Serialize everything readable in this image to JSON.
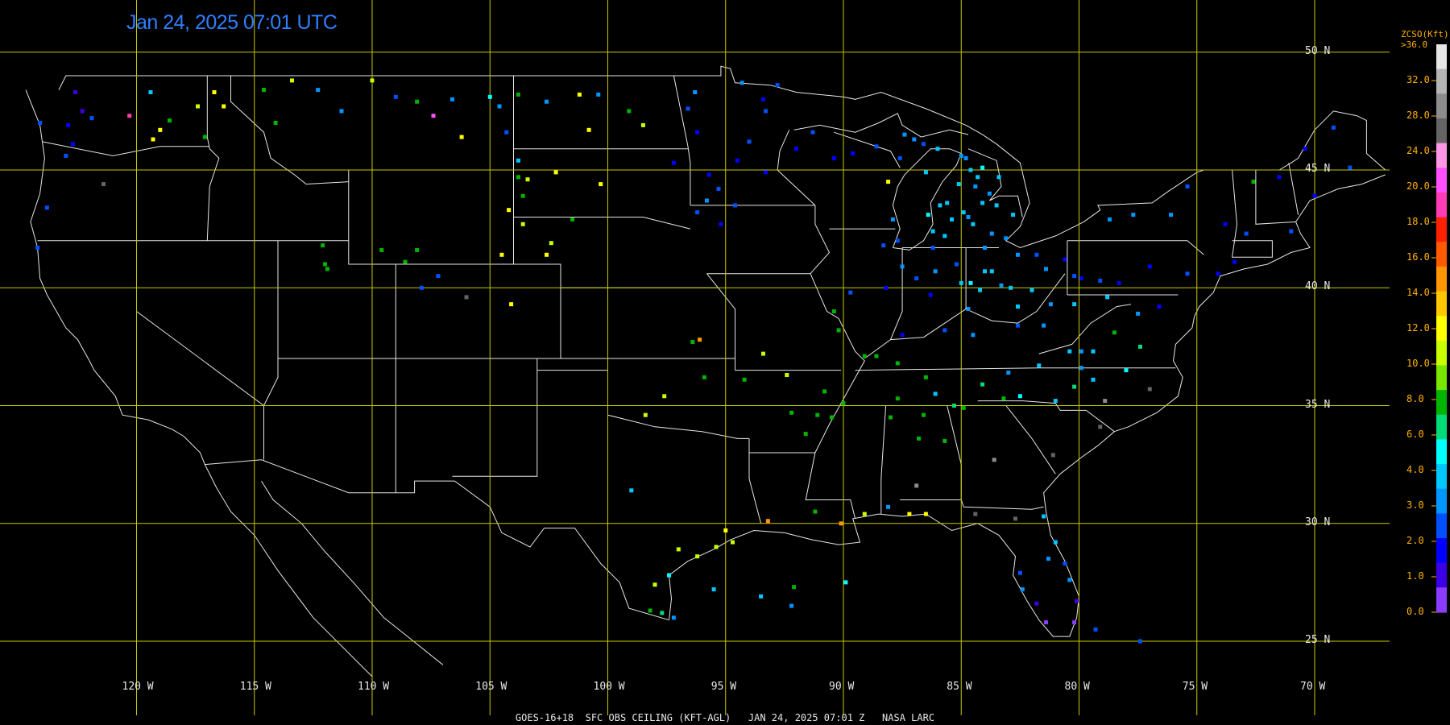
{
  "header": {
    "timestamp": "Jan 24, 2025 07:01 UTC"
  },
  "footer": {
    "caption": "GOES-16+18  SFC OBS CEILING (KFT-AGL)   JAN 24, 2025 07:01 Z   NASA LARC"
  },
  "colors": {
    "grid": "#c8c800",
    "borders": "#e6e6e6",
    "title": "#2f7fff",
    "legend_text": "#ffb000"
  },
  "map": {
    "projection": "equirectangular",
    "lon_range": [
      -125,
      -67
    ],
    "lat_range": [
      24,
      51
    ],
    "latitude_labels": [
      {
        "lat": 50,
        "text": "50 N"
      },
      {
        "lat": 45,
        "text": "45 N"
      },
      {
        "lat": 40,
        "text": "40 N"
      },
      {
        "lat": 35,
        "text": "35 N"
      },
      {
        "lat": 30,
        "text": "30 N"
      },
      {
        "lat": 25,
        "text": "25 N"
      }
    ],
    "longitude_labels": [
      {
        "lon": -120,
        "text": "120 W"
      },
      {
        "lon": -115,
        "text": "115 W"
      },
      {
        "lon": -110,
        "text": "110 W"
      },
      {
        "lon": -105,
        "text": "105 W"
      },
      {
        "lon": -100,
        "text": "100 W"
      },
      {
        "lon": -95,
        "text": "95 W"
      },
      {
        "lon": -90,
        "text": "90 W"
      },
      {
        "lon": -85,
        "text": "85 W"
      },
      {
        "lon": -80,
        "text": "80 W"
      },
      {
        "lon": -75,
        "text": "75 W"
      },
      {
        "lon": -70,
        "text": "70 W"
      }
    ]
  },
  "legend": {
    "title": "ZCSO(Kft)",
    "top_label": ">36.0",
    "ticks": [
      "32.0",
      "28.0",
      "24.0",
      "20.0",
      "18.0",
      "16.0",
      "14.0",
      "12.0",
      "10.0",
      "8.0",
      "6.0",
      "4.0",
      "3.0",
      "2.0",
      "1.0",
      "0.0"
    ],
    "colors": [
      "#e6e6e6",
      "#b4b4b4",
      "#8c8c8c",
      "#646464",
      "#ff96e6",
      "#ff50ff",
      "#ff3cb4",
      "#ff2000",
      "#ff5a00",
      "#ff9600",
      "#ffc800",
      "#ffff00",
      "#c8ff00",
      "#78e600",
      "#00b400",
      "#00dc78",
      "#00ffff",
      "#00c8ff",
      "#0096ff",
      "#0050ff",
      "#0000ff",
      "#3c00e6",
      "#8c3cff"
    ]
  },
  "chart_data": {
    "type": "scatter",
    "title": "",
    "xlabel": "",
    "ylabel": "",
    "xlim": [
      -125,
      -67
    ],
    "ylim": [
      24,
      51
    ],
    "note_units": "ceiling kft AGL",
    "points": [
      [
        -122.3,
        47.5,
        0.8
      ],
      [
        -122.6,
        48.3,
        0.9
      ],
      [
        -121.9,
        47.2,
        2.0
      ],
      [
        -122.9,
        46.9,
        1.5
      ],
      [
        -123.0,
        45.6,
        2.0
      ],
      [
        -124.1,
        47.0,
        2.5
      ],
      [
        -122.7,
        46.1,
        1.5
      ],
      [
        -123.8,
        43.4,
        2.0
      ],
      [
        -124.2,
        41.7,
        2.5
      ],
      [
        -119.4,
        48.3,
        4.0
      ],
      [
        -117.4,
        47.7,
        10.0
      ],
      [
        -116.3,
        47.7,
        12.0
      ],
      [
        -117.1,
        46.4,
        8.0
      ],
      [
        -118.6,
        47.1,
        8.0
      ],
      [
        -120.3,
        47.3,
        18.0
      ],
      [
        -119.3,
        46.3,
        12.0
      ],
      [
        -121.4,
        44.4,
        24.0
      ],
      [
        -119.0,
        46.7,
        12.0
      ],
      [
        -116.7,
        48.3,
        12.0
      ],
      [
        -114.6,
        48.4,
        8.0
      ],
      [
        -114.1,
        47.0,
        7.0
      ],
      [
        -113.4,
        48.8,
        10.0
      ],
      [
        -112.3,
        48.4,
        3.0
      ],
      [
        -111.3,
        47.5,
        3.0
      ],
      [
        -110.0,
        48.8,
        10.0
      ],
      [
        -109.0,
        48.1,
        2.5
      ],
      [
        -108.1,
        47.9,
        7.0
      ],
      [
        -106.6,
        48.0,
        3.0
      ],
      [
        -105.0,
        48.1,
        5.0
      ],
      [
        -104.6,
        47.7,
        3.0
      ],
      [
        -107.4,
        47.3,
        20.0
      ],
      [
        -106.2,
        46.4,
        12.0
      ],
      [
        -104.3,
        46.6,
        2.5
      ],
      [
        -103.8,
        48.2,
        7.0
      ],
      [
        -102.6,
        47.9,
        3.0
      ],
      [
        -101.2,
        48.2,
        12.0
      ],
      [
        -100.4,
        48.2,
        3.0
      ],
      [
        -99.1,
        47.5,
        8.0
      ],
      [
        -98.5,
        46.9,
        10.0
      ],
      [
        -100.8,
        46.7,
        12.0
      ],
      [
        -103.8,
        45.4,
        4.0
      ],
      [
        -102.2,
        44.9,
        12.0
      ],
      [
        -100.3,
        44.4,
        12.0
      ],
      [
        -103.4,
        44.6,
        10.0
      ],
      [
        -104.2,
        43.3,
        12.0
      ],
      [
        -101.5,
        42.9,
        8.0
      ],
      [
        -96.6,
        47.6,
        2.0
      ],
      [
        -96.2,
        46.6,
        1.5
      ],
      [
        -97.2,
        45.3,
        1.0
      ],
      [
        -95.7,
        44.8,
        1.5
      ],
      [
        -94.5,
        45.4,
        1.0
      ],
      [
        -94.0,
        46.2,
        2.0
      ],
      [
        -93.3,
        44.9,
        1.5
      ],
      [
        -92.0,
        45.9,
        1.0
      ],
      [
        -91.3,
        46.6,
        2.0
      ],
      [
        -90.4,
        45.5,
        1.5
      ],
      [
        -89.6,
        45.7,
        1.0
      ],
      [
        -88.6,
        46.0,
        2.0
      ],
      [
        -87.6,
        45.5,
        2.5
      ],
      [
        -88.1,
        44.5,
        12.0
      ],
      [
        -87.0,
        46.3,
        3.0
      ],
      [
        -86.0,
        45.9,
        4.0
      ],
      [
        -84.8,
        45.5,
        3.0
      ],
      [
        -84.3,
        44.7,
        4.0
      ],
      [
        -83.7,
        42.3,
        3.0
      ],
      [
        -84.7,
        43.0,
        3.5
      ],
      [
        -85.4,
        42.9,
        4.0
      ],
      [
        -86.2,
        42.4,
        4.0
      ],
      [
        -83.1,
        42.1,
        3.0
      ],
      [
        -82.6,
        41.4,
        3.0
      ],
      [
        -81.8,
        41.4,
        2.5
      ],
      [
        -80.6,
        41.2,
        1.5
      ],
      [
        -79.9,
        40.4,
        1.0
      ],
      [
        -78.3,
        40.2,
        1.5
      ],
      [
        -77.0,
        40.9,
        1.0
      ],
      [
        -75.4,
        40.6,
        2.0
      ],
      [
        -74.1,
        40.6,
        1.5
      ],
      [
        -73.4,
        41.1,
        1.0
      ],
      [
        -72.9,
        42.3,
        2.5
      ],
      [
        -71.0,
        42.4,
        2.0
      ],
      [
        -70.0,
        43.9,
        1.0
      ],
      [
        -76.1,
        43.1,
        3.0
      ],
      [
        -77.7,
        43.1,
        3.5
      ],
      [
        -78.7,
        42.9,
        3.0
      ],
      [
        -73.8,
        42.7,
        1.5
      ],
      [
        -75.4,
        44.3,
        2.0
      ],
      [
        -72.6,
        44.5,
        8.0
      ],
      [
        -71.5,
        44.7,
        1.5
      ],
      [
        -68.5,
        45.1,
        2.0
      ],
      [
        -70.4,
        45.9,
        1.5
      ],
      [
        -69.2,
        46.8,
        2.0
      ],
      [
        -83.3,
        40.1,
        3.0
      ],
      [
        -84.2,
        39.9,
        4.0
      ],
      [
        -84.7,
        39.1,
        3.0
      ],
      [
        -85.7,
        38.2,
        2.0
      ],
      [
        -86.3,
        39.7,
        1.5
      ],
      [
        -87.5,
        38.0,
        1.0
      ],
      [
        -86.9,
        40.4,
        2.0
      ],
      [
        -85.2,
        41.0,
        2.5
      ],
      [
        -88.2,
        40.0,
        1.0
      ],
      [
        -89.7,
        39.8,
        2.0
      ],
      [
        -90.4,
        39.0,
        7.0
      ],
      [
        -90.2,
        38.2,
        7.0
      ],
      [
        -89.1,
        37.1,
        8.0
      ],
      [
        -88.6,
        37.1,
        7.0
      ],
      [
        -87.7,
        36.8,
        7.0
      ],
      [
        -86.5,
        36.2,
        7.0
      ],
      [
        -85.3,
        35.0,
        6.0
      ],
      [
        -84.1,
        35.9,
        6.0
      ],
      [
        -83.0,
        36.4,
        3.0
      ],
      [
        -81.7,
        36.7,
        4.0
      ],
      [
        -80.4,
        37.3,
        4.0
      ],
      [
        -79.4,
        37.3,
        4.0
      ],
      [
        -78.5,
        38.1,
        7.0
      ],
      [
        -77.4,
        37.5,
        6.0
      ],
      [
        -76.6,
        39.2,
        1.0
      ],
      [
        -77.5,
        38.9,
        3.0
      ],
      [
        -79.9,
        37.3,
        3.0
      ],
      [
        -81.5,
        38.4,
        3.0
      ],
      [
        -82.6,
        38.4,
        2.0
      ],
      [
        -84.5,
        38.0,
        3.0
      ],
      [
        -90.0,
        35.1,
        7.0
      ],
      [
        -91.1,
        34.6,
        7.0
      ],
      [
        -92.2,
        34.7,
        7.0
      ],
      [
        -94.2,
        36.1,
        7.0
      ],
      [
        -92.4,
        36.3,
        10.0
      ],
      [
        -93.4,
        37.2,
        10.0
      ],
      [
        -95.9,
        36.2,
        7.0
      ],
      [
        -97.6,
        35.4,
        10.0
      ],
      [
        -98.4,
        34.6,
        10.0
      ],
      [
        -96.4,
        37.7,
        8.0
      ],
      [
        -96.1,
        37.8,
        14.0
      ],
      [
        -99.0,
        31.4,
        4.0
      ],
      [
        -93.2,
        30.1,
        14.0
      ],
      [
        -91.2,
        30.5,
        8.0
      ],
      [
        -90.1,
        30.0,
        14.0
      ],
      [
        -89.1,
        30.4,
        10.0
      ],
      [
        -88.1,
        30.7,
        3.0
      ],
      [
        -87.2,
        30.4,
        12.0
      ],
      [
        -86.5,
        30.4,
        12.0
      ],
      [
        -84.4,
        30.4,
        24.0
      ],
      [
        -82.7,
        30.2,
        24.0
      ],
      [
        -81.5,
        30.3,
        4.0
      ],
      [
        -82.5,
        27.9,
        2.5
      ],
      [
        -82.4,
        27.2,
        3.0
      ],
      [
        -81.8,
        26.6,
        0.5
      ],
      [
        -81.4,
        25.8,
        0.2
      ],
      [
        -80.2,
        25.8,
        0.3
      ],
      [
        -80.1,
        26.7,
        0.5
      ],
      [
        -80.4,
        27.6,
        3.0
      ],
      [
        -80.6,
        28.3,
        2.0
      ],
      [
        -81.3,
        28.5,
        3.0
      ],
      [
        -81.0,
        29.2,
        4.0
      ],
      [
        -79.3,
        25.5,
        2.0
      ],
      [
        -77.4,
        25.0,
        2.0
      ],
      [
        -97.4,
        27.8,
        5.0
      ],
      [
        -97.7,
        26.2,
        6.0
      ],
      [
        -97.2,
        26.0,
        3.0
      ],
      [
        -98.2,
        26.3,
        7.0
      ],
      [
        -98.0,
        27.4,
        10.0
      ],
      [
        -97.0,
        28.9,
        10.0
      ],
      [
        -96.2,
        28.6,
        10.0
      ],
      [
        -95.4,
        29.0,
        10.0
      ],
      [
        -94.7,
        29.2,
        10.0
      ],
      [
        -95.0,
        29.7,
        12.0
      ],
      [
        -95.5,
        27.2,
        4.0
      ],
      [
        -93.5,
        26.9,
        4.0
      ],
      [
        -92.1,
        27.3,
        7.0
      ],
      [
        -92.2,
        26.5,
        3.0
      ],
      [
        -89.9,
        27.5,
        5.0
      ],
      [
        -90.8,
        35.6,
        7.0
      ],
      [
        -90.5,
        34.5,
        8.0
      ],
      [
        -91.6,
        33.8,
        7.0
      ],
      [
        -88.0,
        34.5,
        7.0
      ],
      [
        -87.7,
        35.3,
        7.0
      ],
      [
        -86.6,
        34.6,
        7.0
      ],
      [
        -86.8,
        33.6,
        8.0
      ],
      [
        -85.7,
        33.5,
        7.0
      ],
      [
        -84.9,
        34.9,
        7.0
      ],
      [
        -86.1,
        35.5,
        4.0
      ],
      [
        -83.2,
        35.3,
        7.0
      ],
      [
        -82.5,
        35.4,
        5.0
      ],
      [
        -81.0,
        35.2,
        4.0
      ],
      [
        -80.2,
        35.8,
        6.0
      ],
      [
        -79.4,
        36.1,
        4.0
      ],
      [
        -77.0,
        35.7,
        24.0
      ],
      [
        -79.1,
        34.1,
        24.0
      ],
      [
        -81.1,
        32.9,
        24.0
      ],
      [
        -79.9,
        36.6,
        3.0
      ],
      [
        -78.0,
        36.5,
        5.0
      ],
      [
        -78.9,
        35.2,
        28.0
      ],
      [
        -83.6,
        32.7,
        28.0
      ],
      [
        -86.9,
        31.6,
        28.0
      ],
      [
        -109.6,
        41.6,
        7.0
      ],
      [
        -108.6,
        41.1,
        7.0
      ],
      [
        -108.1,
        41.6,
        7.0
      ],
      [
        -107.2,
        40.5,
        2.0
      ],
      [
        -107.9,
        40.0,
        2.0
      ],
      [
        -106.0,
        39.6,
        24.0
      ],
      [
        -112.0,
        41.0,
        8.0
      ],
      [
        -111.9,
        40.8,
        8.0
      ],
      [
        -112.1,
        41.8,
        7.0
      ],
      [
        -104.1,
        39.3,
        12.0
      ],
      [
        -103.6,
        42.7,
        10.0
      ],
      [
        -102.6,
        41.4,
        12.0
      ],
      [
        -102.4,
        41.9,
        10.0
      ],
      [
        -104.5,
        41.4,
        12.0
      ],
      [
        -103.6,
        43.9,
        8.0
      ],
      [
        -103.8,
        44.7,
        7.0
      ],
      [
        -94.3,
        48.7,
        3.0
      ],
      [
        -93.4,
        48.0,
        1.5
      ],
      [
        -92.8,
        48.6,
        2.0
      ],
      [
        -96.3,
        48.3,
        3.0
      ],
      [
        -94.6,
        43.5,
        2.0
      ],
      [
        -95.3,
        44.2,
        2.5
      ],
      [
        -95.8,
        43.7,
        3.0
      ],
      [
        -96.2,
        43.2,
        2.0
      ],
      [
        -95.2,
        42.7,
        1.5
      ],
      [
        -93.3,
        47.5,
        2.0
      ],
      [
        -85.9,
        43.5,
        4.0
      ],
      [
        -84.9,
        43.2,
        4.0
      ],
      [
        -84.1,
        43.6,
        4.0
      ],
      [
        -83.8,
        44.0,
        3.0
      ],
      [
        -86.5,
        44.9,
        4.0
      ],
      [
        -85.0,
        45.6,
        3.0
      ],
      [
        -84.0,
        41.7,
        3.0
      ],
      [
        -85.7,
        42.2,
        4.0
      ],
      [
        -84.5,
        42.7,
        4.0
      ],
      [
        -86.2,
        41.7,
        2.0
      ],
      [
        -86.4,
        43.1,
        5.0
      ],
      [
        -85.6,
        43.6,
        4.0
      ],
      [
        -83.5,
        43.5,
        4.0
      ],
      [
        -82.8,
        43.1,
        4.0
      ],
      [
        -85.1,
        44.4,
        4.0
      ],
      [
        -84.4,
        44.3,
        3.0
      ],
      [
        -84.6,
        45.0,
        4.0
      ],
      [
        -84.1,
        45.1,
        5.0
      ],
      [
        -83.4,
        44.7,
        4.0
      ],
      [
        -87.4,
        46.5,
        3.0
      ],
      [
        -86.6,
        46.1,
        2.0
      ],
      [
        -87.9,
        42.9,
        3.0
      ],
      [
        -87.7,
        42.0,
        2.5
      ],
      [
        -88.3,
        41.8,
        2.5
      ],
      [
        -87.5,
        40.9,
        3.0
      ],
      [
        -86.1,
        40.7,
        3.5
      ],
      [
        -85.0,
        40.2,
        4.0
      ],
      [
        -84.0,
        40.7,
        4.0
      ],
      [
        -82.9,
        40.0,
        4.0
      ],
      [
        -81.4,
        40.8,
        3.0
      ],
      [
        -82.0,
        39.9,
        4.0
      ],
      [
        -81.2,
        39.3,
        3.0
      ],
      [
        -80.2,
        39.3,
        4.0
      ],
      [
        -79.1,
        40.3,
        2.0
      ],
      [
        -80.2,
        40.5,
        2.0
      ],
      [
        -78.8,
        39.6,
        4.0
      ],
      [
        -82.6,
        39.2,
        4.0
      ],
      [
        -84.6,
        40.2,
        5.0
      ],
      [
        -83.7,
        40.7,
        4.0
      ]
    ]
  }
}
